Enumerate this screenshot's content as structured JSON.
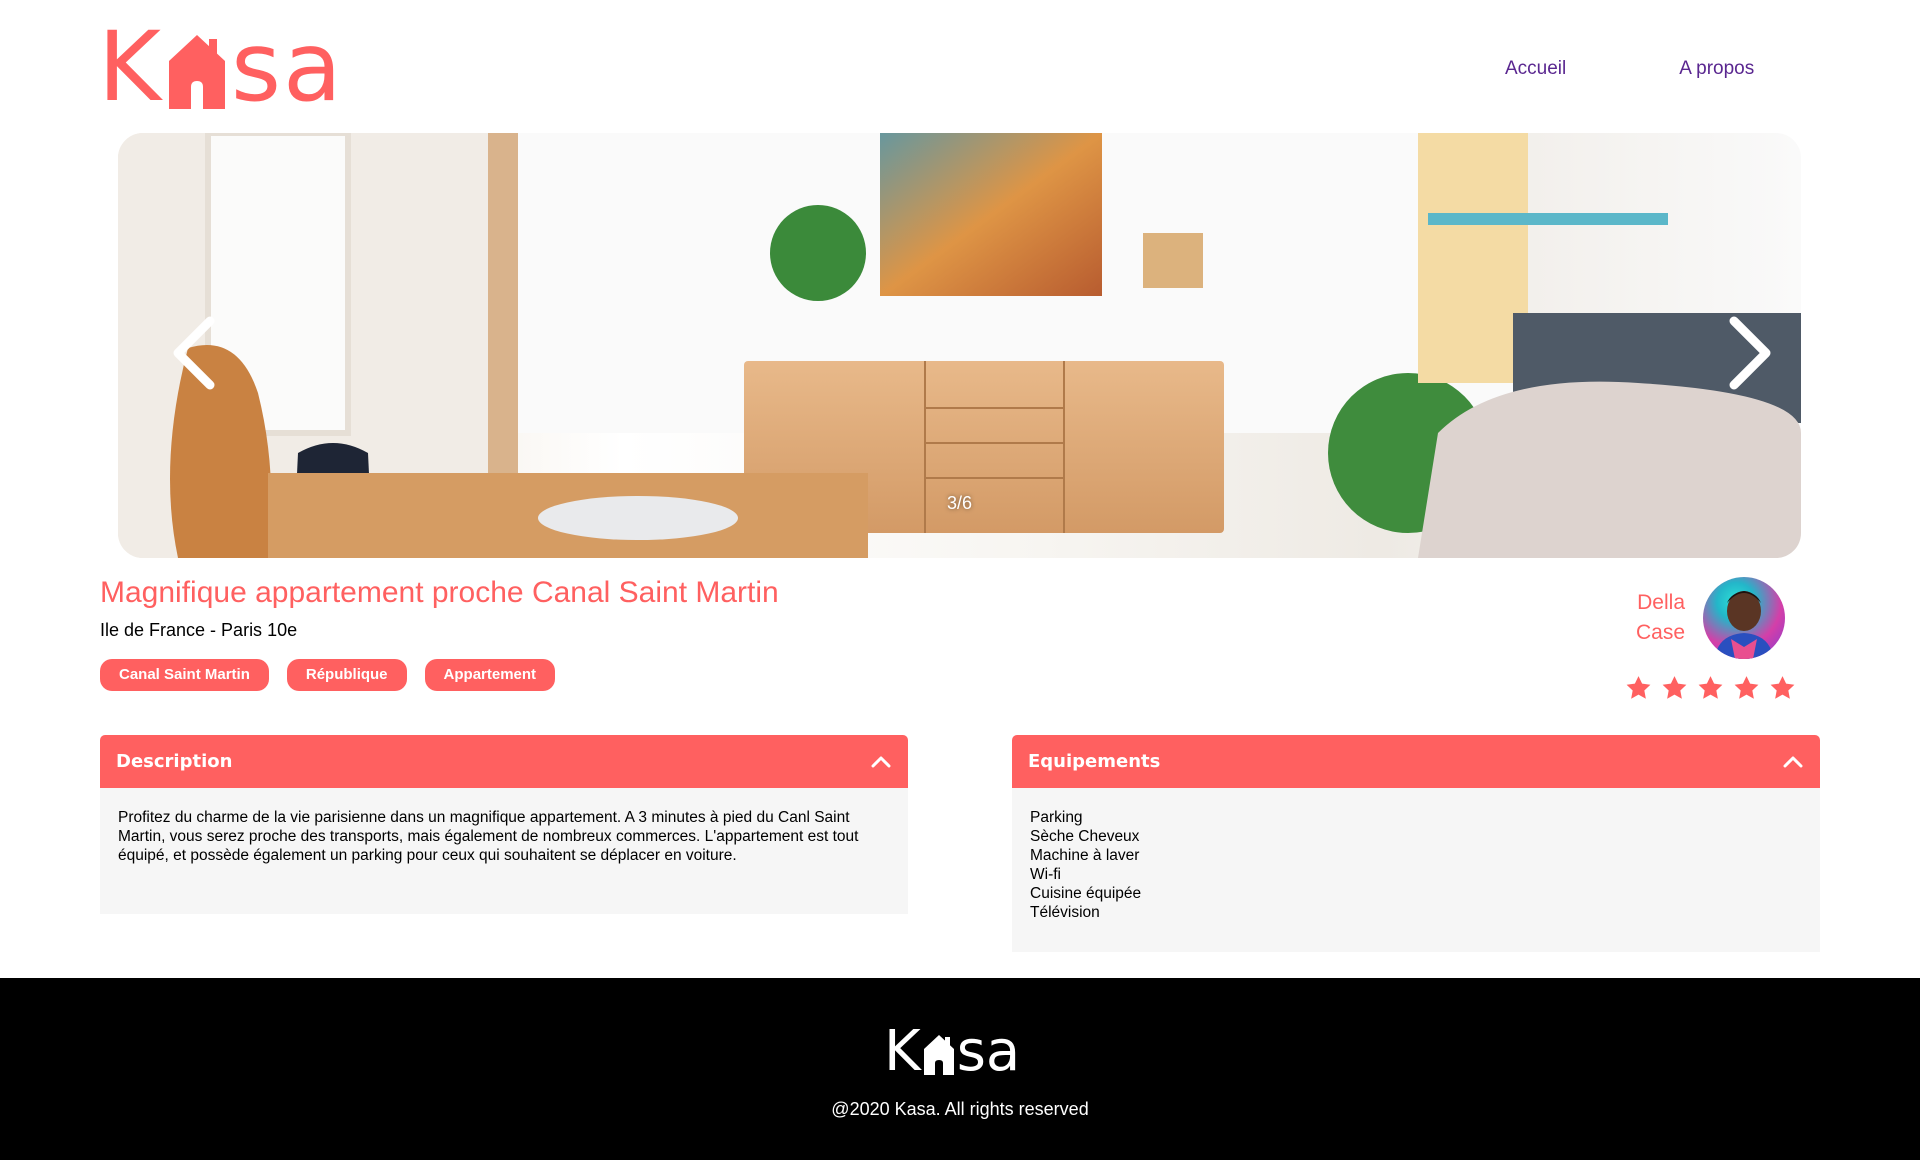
{
  "brand": {
    "name": "Kasa",
    "letters": [
      "K",
      "s",
      "a"
    ],
    "accent_color": "#FF6060"
  },
  "nav": {
    "home": "Accueil",
    "about": "A propos"
  },
  "carousel": {
    "counter": "3/6",
    "prev_icon": "chevron-left-icon",
    "next_icon": "chevron-right-icon"
  },
  "listing": {
    "title": "Magnifique appartement proche Canal Saint Martin",
    "location": "Ile de France - Paris 10e",
    "tags": [
      "Canal Saint Martin",
      "République",
      "Appartement"
    ],
    "rating": 5,
    "rating_max": 5
  },
  "host": {
    "first_name": "Della",
    "last_name": "Case"
  },
  "description": {
    "title": "Description",
    "text": "Profitez du charme de la vie parisienne dans un magnifique appartement. A 3 minutes à pied du Canl Saint Martin, vous serez proche des transports, mais également de nombreux commerces. L'appartement est tout équipé, et possède également un parking pour ceux qui souhaitent se déplacer en voiture."
  },
  "equipments": {
    "title": "Equipements",
    "items": [
      "Parking",
      "Sèche Cheveux",
      "Machine à laver",
      "Wi-fi",
      "Cuisine équipée",
      "Télévision"
    ]
  },
  "footer": {
    "copyright": "@2020 Kasa. All rights reserved"
  }
}
